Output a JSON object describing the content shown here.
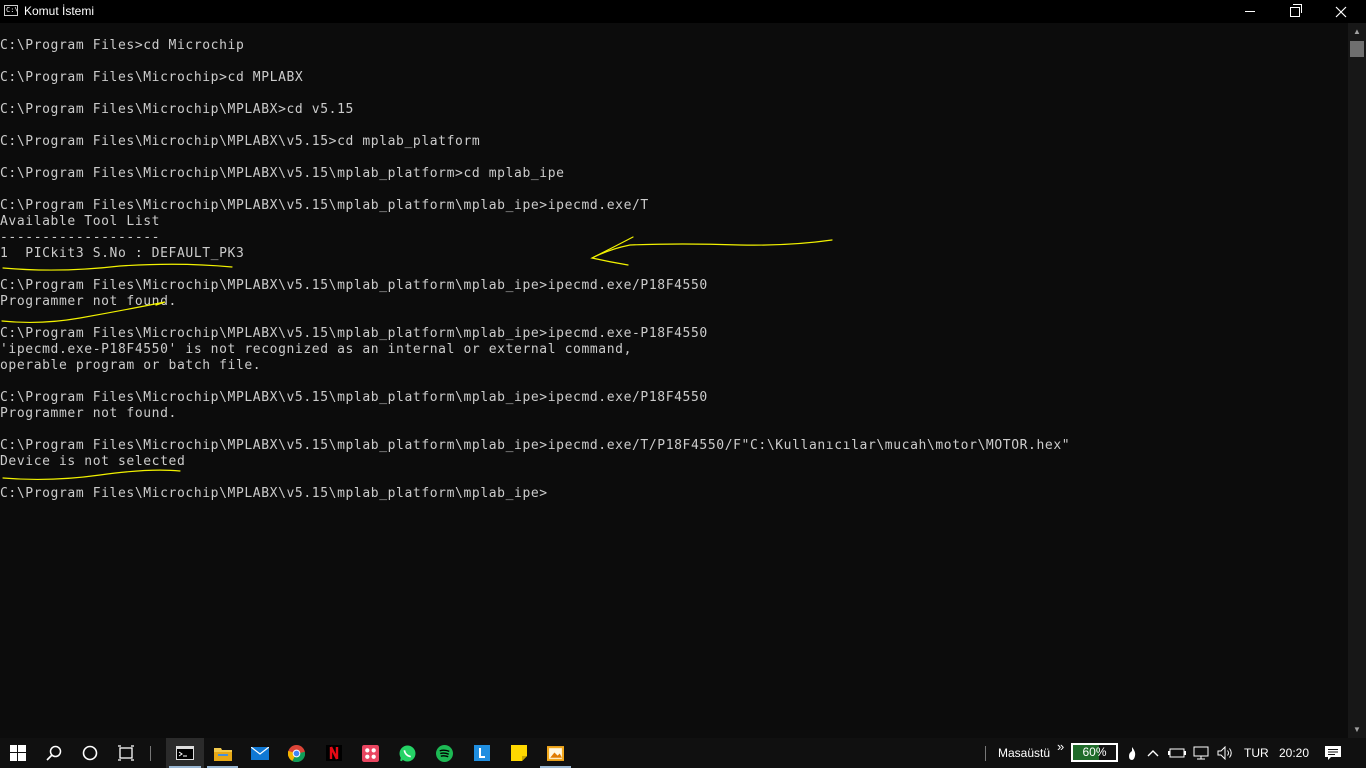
{
  "window": {
    "title": "Komut İstemi",
    "icon": "cmd-icon",
    "icon_text": "C:\\"
  },
  "console": {
    "lines": [
      "C:\\Program Files>cd Microchip",
      "",
      "C:\\Program Files\\Microchip>cd MPLABX",
      "",
      "C:\\Program Files\\Microchip\\MPLABX>cd v5.15",
      "",
      "C:\\Program Files\\Microchip\\MPLABX\\v5.15>cd mplab_platform",
      "",
      "C:\\Program Files\\Microchip\\MPLABX\\v5.15\\mplab_platform>cd mplab_ipe",
      "",
      "C:\\Program Files\\Microchip\\MPLABX\\v5.15\\mplab_platform\\mplab_ipe>ipecmd.exe/T",
      "Available Tool List",
      "-------------------",
      "1  PICkit3 S.No : DEFAULT_PK3",
      "",
      "C:\\Program Files\\Microchip\\MPLABX\\v5.15\\mplab_platform\\mplab_ipe>ipecmd.exe/P18F4550",
      "Programmer not found.",
      "",
      "C:\\Program Files\\Microchip\\MPLABX\\v5.15\\mplab_platform\\mplab_ipe>ipecmd.exe-P18F4550",
      "'ipecmd.exe-P18F4550' is not recognized as an internal or external command,",
      "operable program or batch file.",
      "",
      "C:\\Program Files\\Microchip\\MPLABX\\v5.15\\mplab_platform\\mplab_ipe>ipecmd.exe/P18F4550",
      "Programmer not found.",
      "",
      "C:\\Program Files\\Microchip\\MPLABX\\v5.15\\mplab_platform\\mplab_ipe>ipecmd.exe/T/P18F4550/F\"C:\\Kullanıcılar\\mucah\\motor\\MOTOR.hex\"",
      "Device is not selected",
      "",
      "C:\\Program Files\\Microchip\\MPLABX\\v5.15\\mplab_platform\\mplab_ipe>"
    ]
  },
  "annotations": {
    "color": "#f2f200"
  },
  "taskbar": {
    "apps": [
      {
        "name": "start-icon"
      },
      {
        "name": "search-icon"
      },
      {
        "name": "cortana-icon"
      },
      {
        "name": "task-view-icon"
      },
      {
        "name": "cmd-icon",
        "active": true
      },
      {
        "name": "file-explorer-icon",
        "open": true
      },
      {
        "name": "mail-icon"
      },
      {
        "name": "chrome-icon"
      },
      {
        "name": "netflix-icon"
      },
      {
        "name": "photo-app-icon"
      },
      {
        "name": "whatsapp-icon"
      },
      {
        "name": "spotify-icon"
      },
      {
        "name": "l-app-icon"
      },
      {
        "name": "sticky-notes-icon"
      },
      {
        "name": "pictures-app-icon",
        "open": true
      }
    ],
    "tray": {
      "desktop_label": "Masaüstü",
      "expand_glyph": "»",
      "battery_percent_label": "60%",
      "battery_level": 0.6,
      "language": "TUR",
      "time": "20:20",
      "notification_icon": "action-center-icon"
    }
  }
}
